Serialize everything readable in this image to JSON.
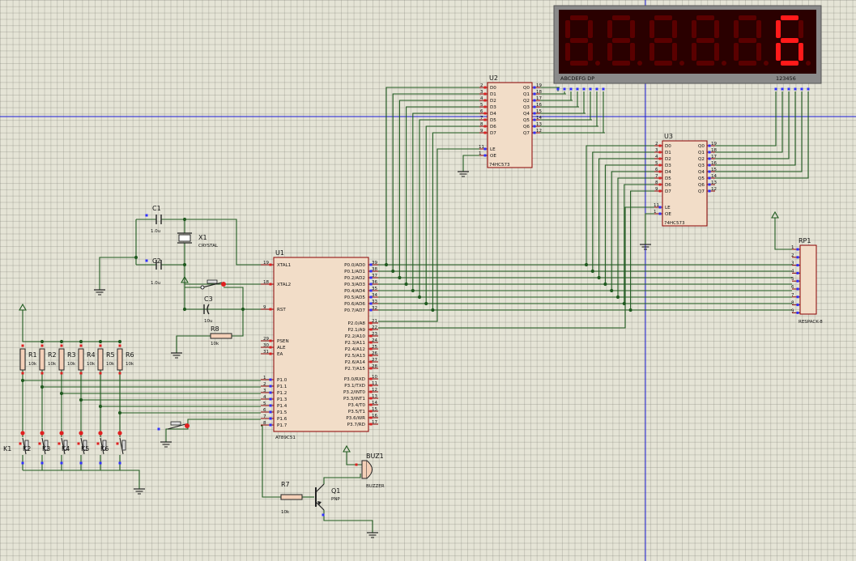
{
  "display": {
    "digits": [
      "",
      "",
      "",
      "",
      "",
      "6"
    ],
    "seg_label": "ABCDEFG DP",
    "com_label": "123456",
    "on_color": "#ff1a1a",
    "off_color": "#5a0000",
    "frame_color": "#8a8a8a",
    "face_color": "#2a0000"
  },
  "u1": {
    "ref": "U1",
    "part": "AT89C51",
    "left_pins": [
      {
        "num": "19",
        "name": "XTAL1"
      },
      {
        "num": "18",
        "name": "XTAL2"
      },
      {
        "num": "9",
        "name": "RST"
      },
      {
        "num": "29",
        "name": "PSEN"
      },
      {
        "num": "30",
        "name": "ALE"
      },
      {
        "num": "31",
        "name": "EA"
      },
      {
        "num": "1",
        "name": "P1.0"
      },
      {
        "num": "2",
        "name": "P1.1"
      },
      {
        "num": "3",
        "name": "P1.2"
      },
      {
        "num": "4",
        "name": "P1.3"
      },
      {
        "num": "5",
        "name": "P1.4"
      },
      {
        "num": "6",
        "name": "P1.5"
      },
      {
        "num": "7",
        "name": "P1.6"
      },
      {
        "num": "8",
        "name": "P1.7"
      }
    ],
    "right_pins": [
      {
        "num": "39",
        "name": "P0.0/AD0"
      },
      {
        "num": "38",
        "name": "P0.1/AD1"
      },
      {
        "num": "37",
        "name": "P0.2/AD2"
      },
      {
        "num": "36",
        "name": "P0.3/AD3"
      },
      {
        "num": "35",
        "name": "P0.4/AD4"
      },
      {
        "num": "34",
        "name": "P0.5/AD5"
      },
      {
        "num": "33",
        "name": "P0.6/AD6"
      },
      {
        "num": "32",
        "name": "P0.7/AD7"
      },
      {
        "num": "21",
        "name": "P2.0/A8"
      },
      {
        "num": "22",
        "name": "P2.1/A9"
      },
      {
        "num": "23",
        "name": "P2.2/A10"
      },
      {
        "num": "24",
        "name": "P2.3/A11"
      },
      {
        "num": "25",
        "name": "P2.4/A12"
      },
      {
        "num": "26",
        "name": "P2.5/A13"
      },
      {
        "num": "27",
        "name": "P2.6/A14"
      },
      {
        "num": "28",
        "name": "P2.7/A15"
      },
      {
        "num": "10",
        "name": "P3.0/RXD"
      },
      {
        "num": "11",
        "name": "P3.1/TXD"
      },
      {
        "num": "12",
        "name": "P3.2/INT0"
      },
      {
        "num": "13",
        "name": "P3.3/INT1"
      },
      {
        "num": "14",
        "name": "P3.4/T0"
      },
      {
        "num": "15",
        "name": "P3.5/T1"
      },
      {
        "num": "16",
        "name": "P3.6/WR"
      },
      {
        "num": "17",
        "name": "P3.7/RD"
      }
    ]
  },
  "u2": {
    "ref": "U2",
    "part": "74HC573",
    "d_pins": [
      {
        "num": "2",
        "name": "D0"
      },
      {
        "num": "3",
        "name": "D1"
      },
      {
        "num": "4",
        "name": "D2"
      },
      {
        "num": "5",
        "name": "D3"
      },
      {
        "num": "6",
        "name": "D4"
      },
      {
        "num": "7",
        "name": "D5"
      },
      {
        "num": "8",
        "name": "D6"
      },
      {
        "num": "9",
        "name": "D7"
      }
    ],
    "q_pins": [
      {
        "num": "19",
        "name": "Q0"
      },
      {
        "num": "18",
        "name": "Q1"
      },
      {
        "num": "17",
        "name": "Q2"
      },
      {
        "num": "16",
        "name": "Q3"
      },
      {
        "num": "15",
        "name": "Q4"
      },
      {
        "num": "14",
        "name": "Q5"
      },
      {
        "num": "13",
        "name": "Q6"
      },
      {
        "num": "12",
        "name": "Q7"
      }
    ],
    "ctrl_pins": [
      {
        "num": "11",
        "name": "LE"
      },
      {
        "num": "1",
        "name": "OE"
      }
    ]
  },
  "u3": {
    "ref": "U3",
    "part": "74HC573",
    "d_pins": [
      {
        "num": "2",
        "name": "D0"
      },
      {
        "num": "3",
        "name": "D1"
      },
      {
        "num": "4",
        "name": "D2"
      },
      {
        "num": "5",
        "name": "D3"
      },
      {
        "num": "6",
        "name": "D4"
      },
      {
        "num": "7",
        "name": "D5"
      },
      {
        "num": "8",
        "name": "D6"
      },
      {
        "num": "9",
        "name": "D7"
      }
    ],
    "q_pins": [
      {
        "num": "19",
        "name": "Q0"
      },
      {
        "num": "18",
        "name": "Q1"
      },
      {
        "num": "17",
        "name": "Q2"
      },
      {
        "num": "16",
        "name": "Q3"
      },
      {
        "num": "15",
        "name": "Q4"
      },
      {
        "num": "14",
        "name": "Q5"
      },
      {
        "num": "13",
        "name": "Q6"
      },
      {
        "num": "12",
        "name": "Q7"
      }
    ],
    "ctrl_pins": [
      {
        "num": "11",
        "name": "LE"
      },
      {
        "num": "1",
        "name": "OE"
      }
    ]
  },
  "rp1": {
    "ref": "RP1",
    "part": "RESPACK-8",
    "pins": [
      "1",
      "2",
      "3",
      "4",
      "5",
      "6",
      "7",
      "8",
      "9"
    ]
  },
  "c1": {
    "ref": "C1",
    "value": "1.0u"
  },
  "c2": {
    "ref": "C2",
    "value": "1.0u"
  },
  "c3": {
    "ref": "C3",
    "value": "10u"
  },
  "x1": {
    "ref": "X1",
    "part": "CRYSTAL"
  },
  "r8": {
    "ref": "R8",
    "value": "10k"
  },
  "r7": {
    "ref": "R7",
    "value": "10k"
  },
  "q1": {
    "ref": "Q1",
    "part": "PNP"
  },
  "buz1": {
    "ref": "BUZ1",
    "part": "BUZZER"
  },
  "pullups": [
    {
      "ref": "R1",
      "value": "10k"
    },
    {
      "ref": "R2",
      "value": "10k"
    },
    {
      "ref": "R3",
      "value": "10k"
    },
    {
      "ref": "R4",
      "value": "10k"
    },
    {
      "ref": "R5",
      "value": "10k"
    },
    {
      "ref": "R6",
      "value": "10k"
    }
  ],
  "keys": [
    "K1",
    "K2",
    "K3",
    "K4",
    "K5",
    "K6"
  ],
  "colors": {
    "wire": "#1f5a1f",
    "body_fill": "#f2ddc8",
    "body_stroke": "#8b0000",
    "guide": "#1b1bd8",
    "pin_blue": "#3030ff",
    "pin_red": "#e02020"
  }
}
